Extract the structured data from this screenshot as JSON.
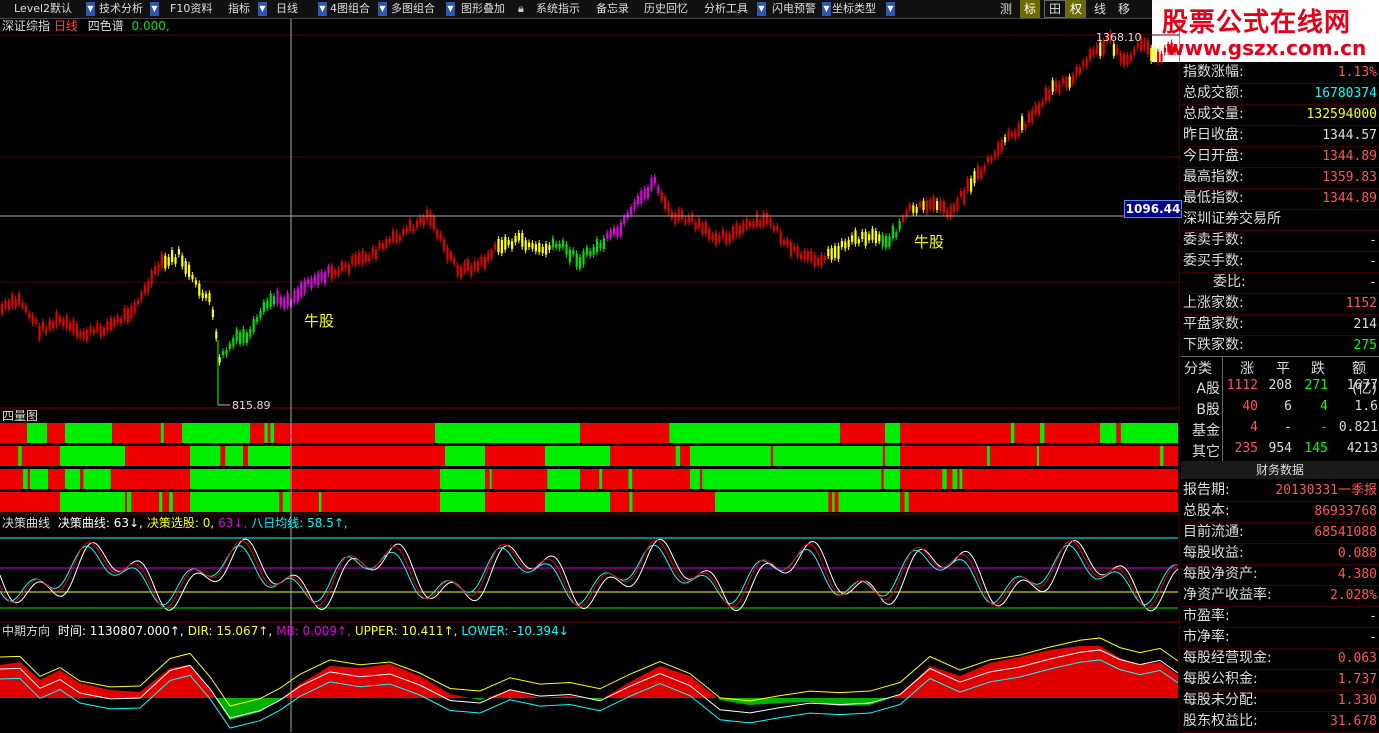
{
  "toolbar": {
    "items": [
      "Level2默认",
      "技术分析",
      "F10资料",
      "指标",
      "日线",
      "4图组合",
      "多图组合",
      "图形叠加",
      "系统指示",
      "备忘录",
      "历史回忆",
      "分析工具",
      "闪电预警",
      "坐标类型"
    ],
    "right": [
      "测",
      "标",
      "田",
      "权",
      "线",
      "移"
    ]
  },
  "watermark": {
    "title": "股票公式在线网",
    "url": "www.gszx.com.cn"
  },
  "main_chart": {
    "index_name": "深证综指",
    "period": "日线",
    "indicator": "四色谱",
    "indicator_value": "0.000,",
    "high_label": "1368.10",
    "low_label": "815.89",
    "crosshair_price": "1096.44",
    "annotations": [
      "牛股",
      "牛股"
    ],
    "colors": {
      "up": "#e00000",
      "down_yellow": "#ffff00",
      "green": "#00e000",
      "magenta": "#e000e0"
    }
  },
  "four_quadrant": {
    "title": "四量图"
  },
  "decision_panel": {
    "name": "决策曲线",
    "labels": [
      {
        "text": "决策曲线: 63↓,",
        "color": "#ffffff"
      },
      {
        "text": "决策选股: 0,",
        "color": "#ffff00"
      },
      {
        "text": "63↓,",
        "color": "#e000e0"
      },
      {
        "text": "八日均线: 58.5↑,",
        "color": "#00ffff"
      }
    ]
  },
  "trend_panel": {
    "name": "中期方向",
    "labels": [
      {
        "text": "时间: 1130807.000↑,",
        "color": "#ffffff"
      },
      {
        "text": "DIR: 15.067↑,",
        "color": "#ffff00"
      },
      {
        "text": "MB: 0.009↑,",
        "color": "#e000e0"
      },
      {
        "text": "UPPER: 10.411↑,",
        "color": "#ffff00"
      },
      {
        "text": "LOWER: -10.394↓",
        "color": "#00ffff"
      }
    ]
  },
  "index_info": {
    "rows": [
      {
        "label": "指数涨幅:",
        "value": "1.13%",
        "color": "#ff5555"
      },
      {
        "label": "总成交额:",
        "value": "16780374",
        "color": "#00ffff"
      },
      {
        "label": "总成交量:",
        "value": "132594000",
        "color": "#ffff00"
      },
      {
        "label": "昨日收盘:",
        "value": "1344.57",
        "color": "#dddddd"
      },
      {
        "label": "今日开盘:",
        "value": "1344.89",
        "color": "#ff5555"
      },
      {
        "label": "最高指数:",
        "value": "1359.83",
        "color": "#ff5555"
      },
      {
        "label": "最低指数:",
        "value": "1344.89",
        "color": "#ff5555"
      },
      {
        "label": "深圳证券交易所",
        "value": "",
        "color": "#dddddd"
      },
      {
        "label": "委卖手数:",
        "value": "-",
        "color": "#dddddd"
      },
      {
        "label": "委买手数:",
        "value": "-",
        "color": "#dddddd"
      },
      {
        "label": "委比:",
        "value": "-",
        "color": "#dddddd"
      },
      {
        "label": "上涨家数:",
        "value": "1152",
        "color": "#ff5555"
      },
      {
        "label": "平盘家数:",
        "value": "214",
        "color": "#dddddd"
      },
      {
        "label": "下跌家数:",
        "value": "275",
        "color": "#00ff00"
      }
    ]
  },
  "classification": {
    "headers": [
      "分类",
      "涨",
      "平",
      "跌",
      "额(亿)"
    ],
    "rows": [
      {
        "name": "A股",
        "up": "1112",
        "flat": "208",
        "down": "271",
        "amount": "1677"
      },
      {
        "name": "B股",
        "up": "40",
        "flat": "6",
        "down": "4",
        "amount": "1.6"
      },
      {
        "name": "基金",
        "up": "4",
        "flat": "-",
        "down": "-",
        "amount": "0.821"
      },
      {
        "name": "其它",
        "up": "235",
        "flat": "954",
        "down": "145",
        "amount": "4213"
      }
    ]
  },
  "financial": {
    "title": "财务数据",
    "rows": [
      {
        "label": "报告期:",
        "value": "20130331一季报",
        "color": "#ff5555"
      },
      {
        "label": "总股本:",
        "value": "86933768",
        "color": "#ff5555"
      },
      {
        "label": "目前流通:",
        "value": "68541088",
        "color": "#ff5555"
      },
      {
        "label": "每股收益:",
        "value": "0.088",
        "color": "#ff5555"
      },
      {
        "label": "每股净资产:",
        "value": "4.380",
        "color": "#ff5555"
      },
      {
        "label": "净资产收益率:",
        "value": "2.028%",
        "color": "#ff5555"
      },
      {
        "label": "市盈率:",
        "value": "-",
        "color": "#dddddd"
      },
      {
        "label": "市净率:",
        "value": "-",
        "color": "#dddddd"
      },
      {
        "label": "每股经营现金:",
        "value": "0.063",
        "color": "#ff5555"
      },
      {
        "label": "每股公积金:",
        "value": "1.737",
        "color": "#ff5555"
      },
      {
        "label": "每股未分配:",
        "value": "1.330",
        "color": "#ff5555"
      },
      {
        "label": "股东权益比:",
        "value": "31.678",
        "color": "#ff5555"
      }
    ]
  }
}
